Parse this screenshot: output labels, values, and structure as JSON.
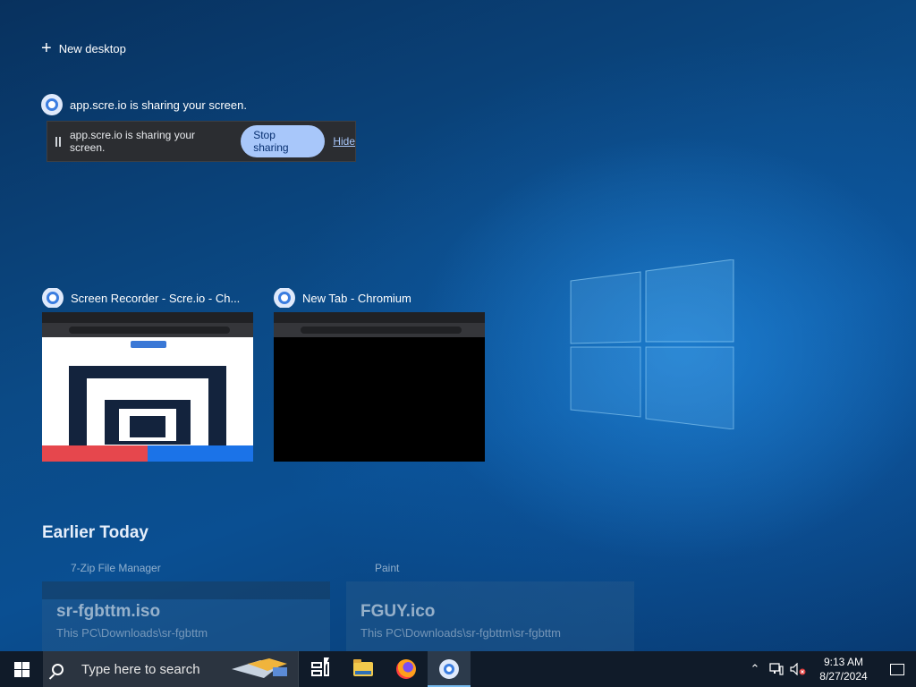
{
  "timeline": {
    "new_desktop": "New desktop",
    "share_notice": "app.scre.io is sharing your screen."
  },
  "share_bar": {
    "text": "app.scre.io is sharing your screen.",
    "stop_label": "Stop sharing",
    "hide_label": "Hide"
  },
  "windows": [
    {
      "title": "Screen Recorder - Scre.io - Ch...",
      "icon": "chromium-icon"
    },
    {
      "title": "New Tab - Chromium",
      "icon": "chromium-icon"
    }
  ],
  "earlier": {
    "heading": "Earlier Today",
    "items": [
      {
        "app": "7-Zip File Manager",
        "title": "sr-fgbttm.iso",
        "path": "This PC\\Downloads\\sr-fgbttm"
      },
      {
        "app": "Paint",
        "title": "FGUY.ico",
        "path": "This PC\\Downloads\\sr-fgbttm\\sr-fgbttm"
      }
    ]
  },
  "taskbar": {
    "search_placeholder": "Type here to search",
    "time": "9:13 AM",
    "date": "8/27/2024",
    "accent": "#76b9ed"
  },
  "thumb1": {
    "colors": {
      "stop": "#e6474d",
      "pause": "#1b73e8"
    }
  }
}
